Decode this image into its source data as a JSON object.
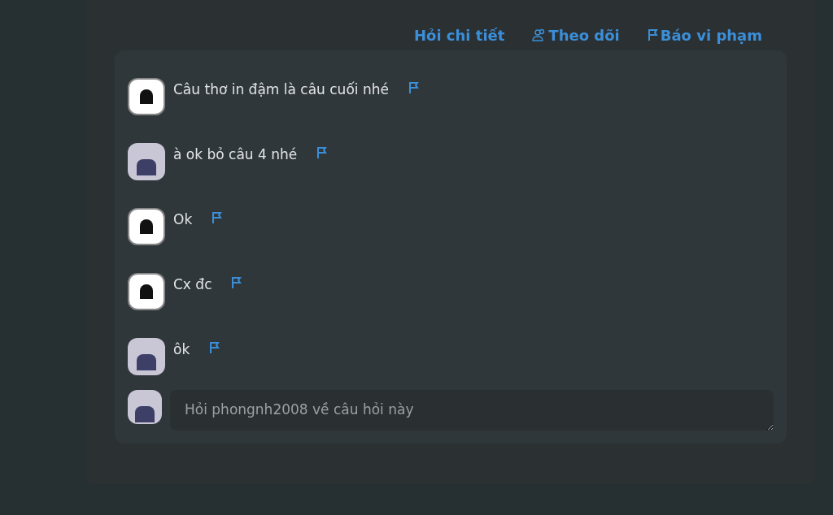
{
  "actions": [
    {
      "label": "Hỏi chi tiết",
      "kind": "plain"
    },
    {
      "label": "Theo dõi",
      "kind": "follow"
    },
    {
      "label": "Báo vi phạm",
      "kind": "report"
    }
  ],
  "comments": [
    {
      "text": "Câu thơ in đậm là câu cuối nhé",
      "kind": "dark"
    },
    {
      "text": "à ok bỏ câu 4 nhé",
      "kind": "light"
    },
    {
      "text": "Ok",
      "kind": "dark"
    },
    {
      "text": "Cx đc",
      "kind": "dark"
    },
    {
      "text": "ôk",
      "kind": "light"
    }
  ],
  "reply": {
    "placeholder": "Hỏi phongnh2008 về câu hỏi này"
  }
}
